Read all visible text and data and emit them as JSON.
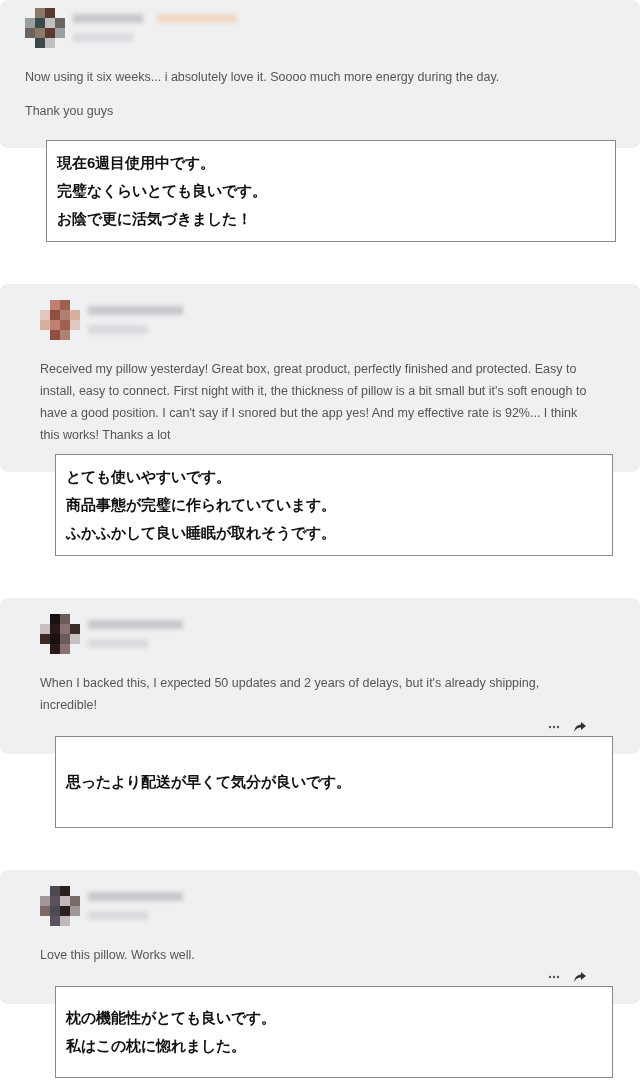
{
  "comments": [
    {
      "badge": true,
      "actions_shown": false,
      "paragraphs": [
        "Now using it six weeks... i absolutely love it. Soooo much more energy during the day.",
        "Thank you guys"
      ],
      "translation": [
        "現在6週目使用中です。",
        "完璧なくらいとても良いです。",
        "お陰で更に活気づきました！"
      ]
    },
    {
      "badge": false,
      "actions_shown": false,
      "paragraphs": [
        "Received my pillow yesterday! Great box, great product, perfectly finished and protected. Easy to install, easy to connect. First night with it, the thickness of pillow is a bit small but it's soft enough to have a good position. I can't say if I snored but the app yes! And my effective rate is 92%... I think this works! Thanks a lot"
      ],
      "translation": [
        "とても使いやすいです。",
        "商品事態が完璧に作られていています。",
        "ふかふかして良い睡眠が取れそうです。"
      ]
    },
    {
      "badge": false,
      "actions_shown": true,
      "paragraphs": [
        "When I backed this, I expected 50 updates and 2 years of delays, but it's already shipping, incredible!"
      ],
      "translation": [
        "思ったより配送が早くて気分が良いです。"
      ]
    },
    {
      "badge": false,
      "actions_shown": true,
      "paragraphs": [
        "Love this pillow. Works well."
      ],
      "translation": [
        "枕の機能性がとても良いです。",
        "私はこの枕に惚れました。"
      ]
    }
  ]
}
